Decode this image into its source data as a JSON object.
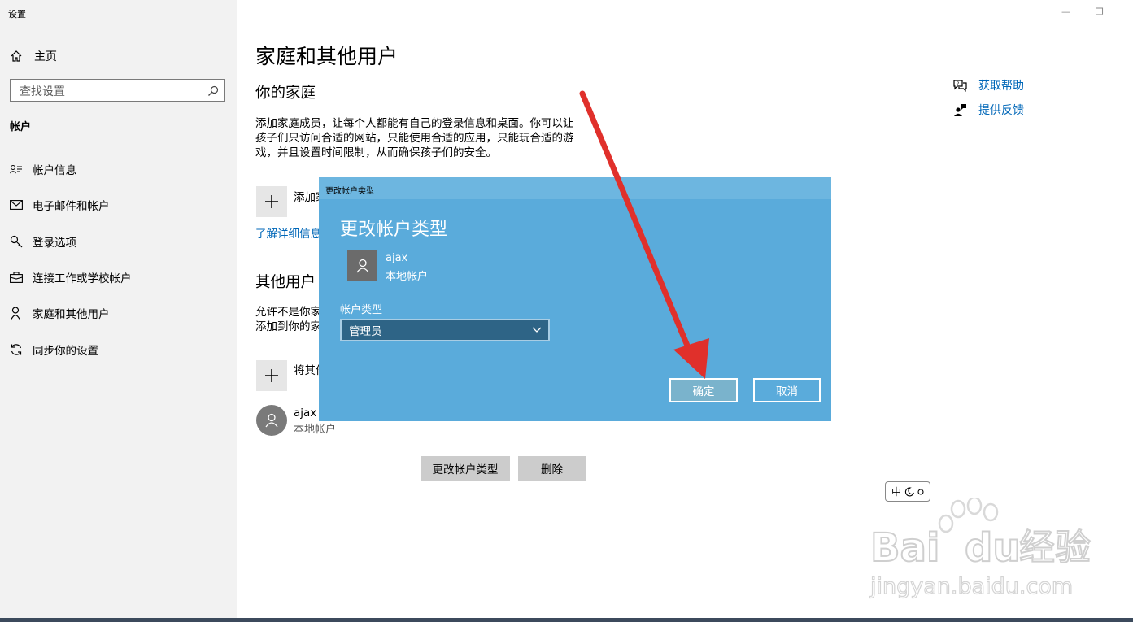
{
  "window": {
    "title": "设置"
  },
  "sidebar": {
    "home_label": "主页",
    "search_placeholder": "查找设置",
    "section_title": "帐户",
    "items": [
      {
        "label": "帐户信息",
        "icon": "account-info-icon"
      },
      {
        "label": "电子邮件和帐户",
        "icon": "mail-icon"
      },
      {
        "label": "登录选项",
        "icon": "key-icon"
      },
      {
        "label": "连接工作或学校帐户",
        "icon": "briefcase-icon"
      },
      {
        "label": "家庭和其他用户",
        "icon": "person-icon"
      },
      {
        "label": "同步你的设置",
        "icon": "sync-icon"
      }
    ]
  },
  "main": {
    "title": "家庭和其他用户",
    "family": {
      "heading": "你的家庭",
      "description_lines": [
        "添加家庭成员，让每个人都能有自己的登录信息和桌面。你可以让",
        "孩子们只访问合适的网站，只能使用合适的应用，只能玩合适的游",
        "戏，并且设置时间限制，从而确保孩子们的安全。"
      ],
      "add_label": "添加家",
      "learn_more": "了解详细信息"
    },
    "others": {
      "heading": "其他用户",
      "description_lines": [
        "允许不是你家",
        "添加到你的家"
      ],
      "add_label": "将其他",
      "user_name": "ajax",
      "user_type": "本地帐户",
      "change_type_button": "更改帐户类型",
      "delete_button": "删除"
    },
    "help": {
      "get_help": "获取帮助",
      "feedback": "提供反馈"
    }
  },
  "dialog": {
    "titlebar": "更改帐户类型",
    "heading": "更改帐户类型",
    "user_name": "ajax",
    "user_type": "本地帐户",
    "field_label": "帐户类型",
    "selected": "管理员",
    "ok_button": "确定",
    "cancel_button": "取消"
  },
  "ime": {
    "lang": "中"
  },
  "watermark": {
    "brand": "Bai du 经验",
    "url": "jingyan.baidu.com"
  },
  "colors": {
    "link": "#0067b8",
    "dialog_bg": "#5aabdb",
    "select_bg": "#2e6486",
    "arrow": "#e53935"
  }
}
